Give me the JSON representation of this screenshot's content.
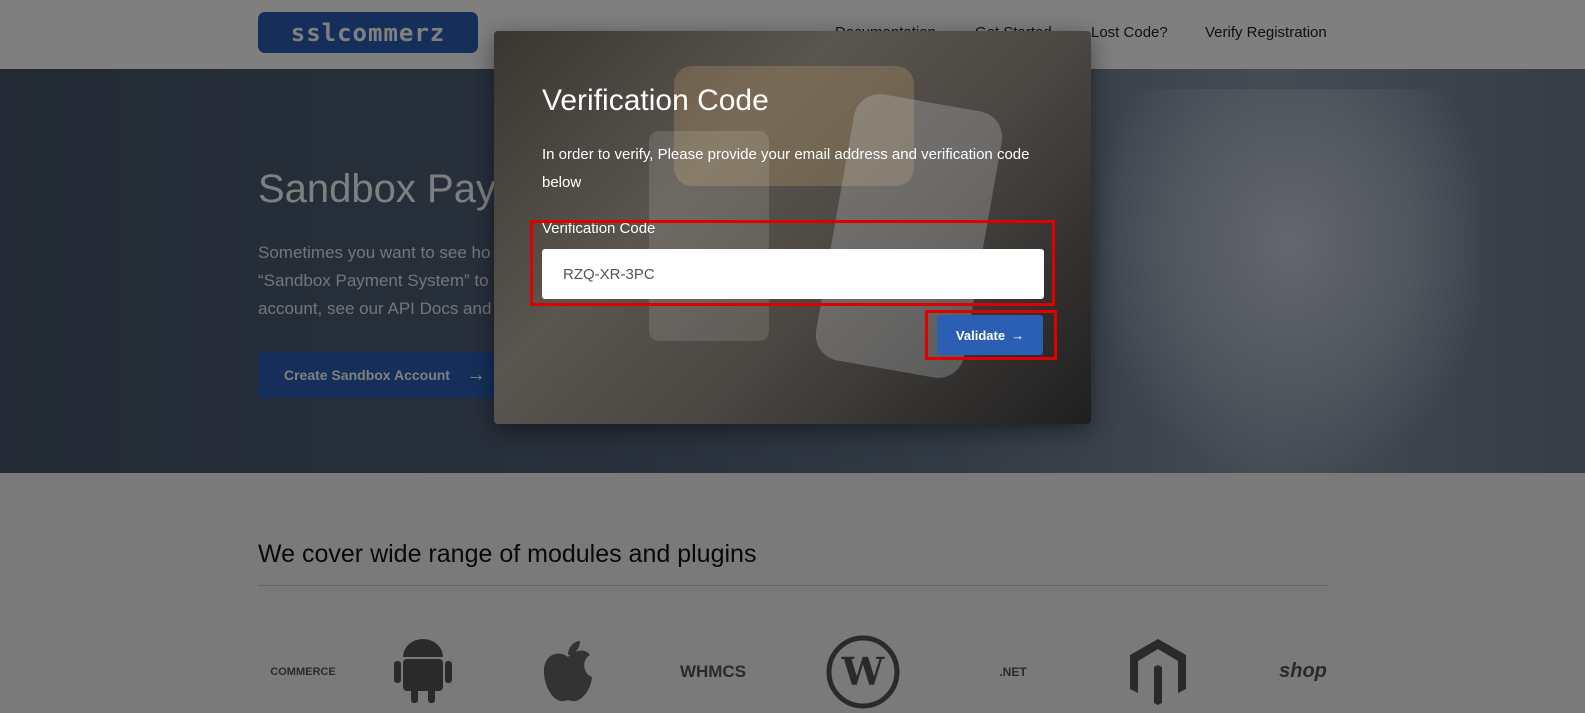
{
  "header": {
    "logo_text": "sslcommerz",
    "nav": [
      "Documentation",
      "Get Started",
      "Lost Code?",
      "Verify Registration"
    ]
  },
  "hero": {
    "title": "Sandbox Pay",
    "text_lines": [
      "Sometimes you want to see ho",
      "“Sandbox Payment System” to",
      "account, see our API Docs and"
    ],
    "button_label": "Create Sandbox Account",
    "button_arrow": "→"
  },
  "section": {
    "title": "We cover wide range of modules and plugins",
    "plugins": [
      {
        "name": "woocommerce",
        "text": "COMMERCE"
      },
      {
        "name": "android",
        "text": ""
      },
      {
        "name": "apple",
        "text": ""
      },
      {
        "name": "whmcs",
        "text": "WHMCS"
      },
      {
        "name": "wordpress",
        "text": ""
      },
      {
        "name": "microsoft-dotnet",
        "text": ".NET"
      },
      {
        "name": "magento",
        "text": ""
      },
      {
        "name": "shopify",
        "text": "shop"
      }
    ]
  },
  "modal": {
    "title": "Verification Code",
    "description": "In order to verify, Please provide your email address and verification code below",
    "field_label": "Verification Code",
    "field_value": "RZQ-XR-3PC",
    "validate_label": "Validate",
    "validate_arrow": "→"
  },
  "colors": {
    "brand": "#2a5fb4",
    "highlight": "#e00000"
  }
}
